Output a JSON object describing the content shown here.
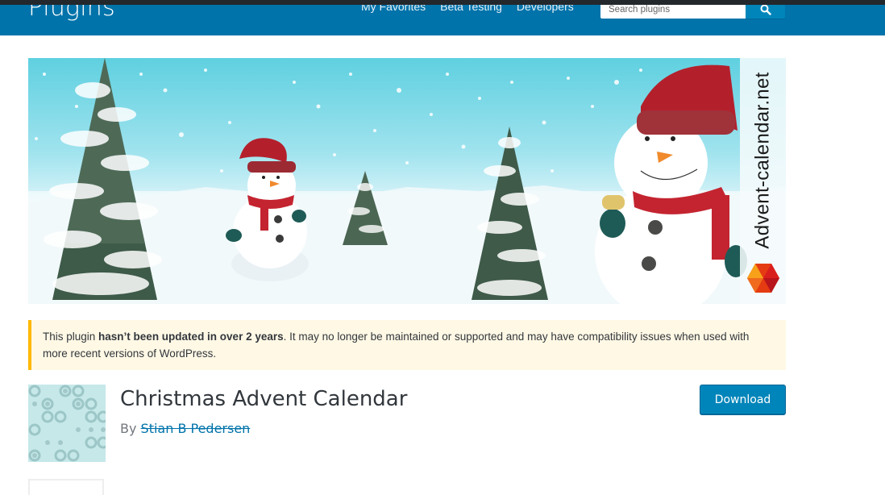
{
  "header": {
    "site_title": "Plugins",
    "nav": [
      {
        "label": "My Favorites"
      },
      {
        "label": "Beta Testing"
      },
      {
        "label": "Developers"
      }
    ],
    "search": {
      "placeholder": "Search plugins",
      "value": "",
      "button_icon": "search-icon"
    }
  },
  "banner": {
    "alt": "Snowmen and snowy pine trees banner",
    "side_text": "Advent-calendar.net",
    "logo": "hexagon-logo"
  },
  "notice": {
    "prefix": "This plugin ",
    "bold": "hasn’t been updated in over 2 years",
    "suffix": ". It may no longer be maintained or supported and may have compatibility issues when used with more recent versions of WordPress."
  },
  "plugin": {
    "title": "Christmas Advent Calendar",
    "by_label": "By ",
    "author": "Stian B Pedersen",
    "download_label": "Download"
  },
  "colors": {
    "header_bg": "#0073aa",
    "topbar_bg": "#23282d",
    "button_bg": "#0085ba",
    "notice_bg": "#fff8e5",
    "notice_border": "#ffb900"
  }
}
